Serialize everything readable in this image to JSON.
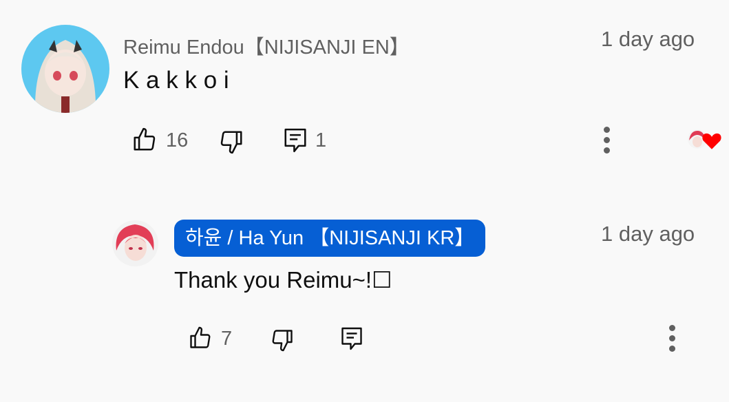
{
  "comments": [
    {
      "author": "Reimu Endou【NIJISANJI EN】",
      "time": "1 day ago",
      "text": "K a k k o i",
      "likes": "16",
      "replies": "1",
      "colors": {
        "meta": "#606060",
        "heart": "#ff0000"
      }
    },
    {
      "author": "하윤 / Ha Yun 【NIJISANJI KR】",
      "time": "1 day ago",
      "text": "Thank you Reimu~!☐",
      "likes": "7",
      "colors": {
        "author_chip": "#065fd4"
      }
    }
  ]
}
